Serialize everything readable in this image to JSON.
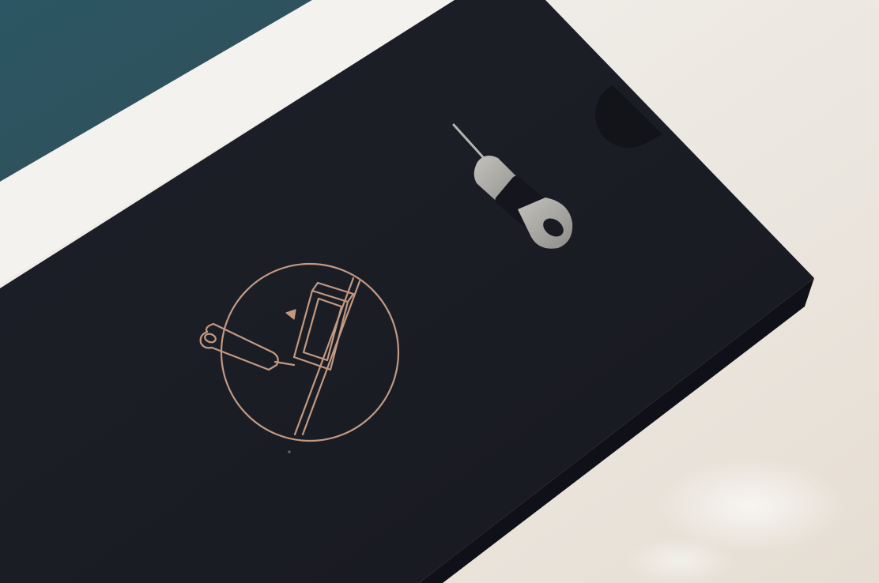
{
  "photo": {
    "subject": "",
    "colors": {
      "background_white": "#ece8e2",
      "teal_panel": "#2f5560",
      "box_black": "#1b1d26",
      "box_side": "#111219",
      "rose_gold_foil": "#c29a82",
      "steel": "#a9a9a5"
    },
    "icons": [
      "sim-eject-tool-icon",
      "sim-eject-pin"
    ]
  }
}
